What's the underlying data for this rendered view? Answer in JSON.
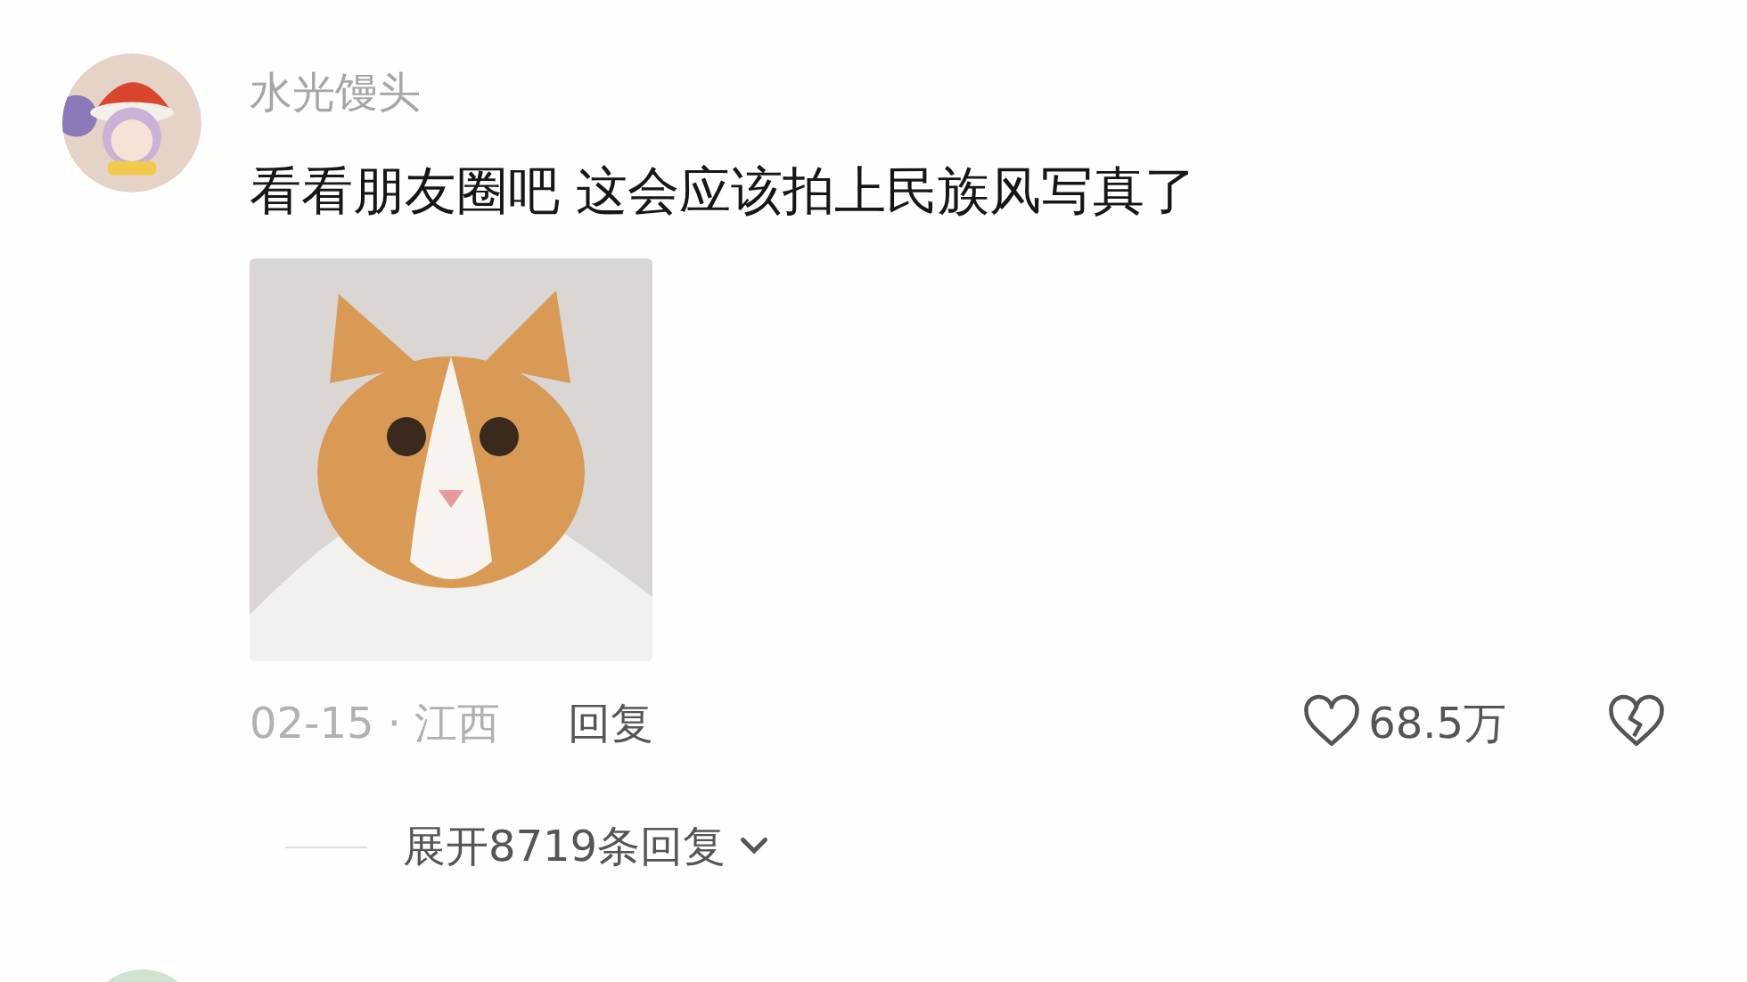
{
  "comment": {
    "username": "水光馒头",
    "text": "看看朋友圈吧 这会应该拍上民族风写真了",
    "meta": "02-15 · 江西",
    "reply_label": "回复",
    "likes": "68.5万",
    "liked": false,
    "disliked": false,
    "expand_label": "展开8719条回复"
  }
}
